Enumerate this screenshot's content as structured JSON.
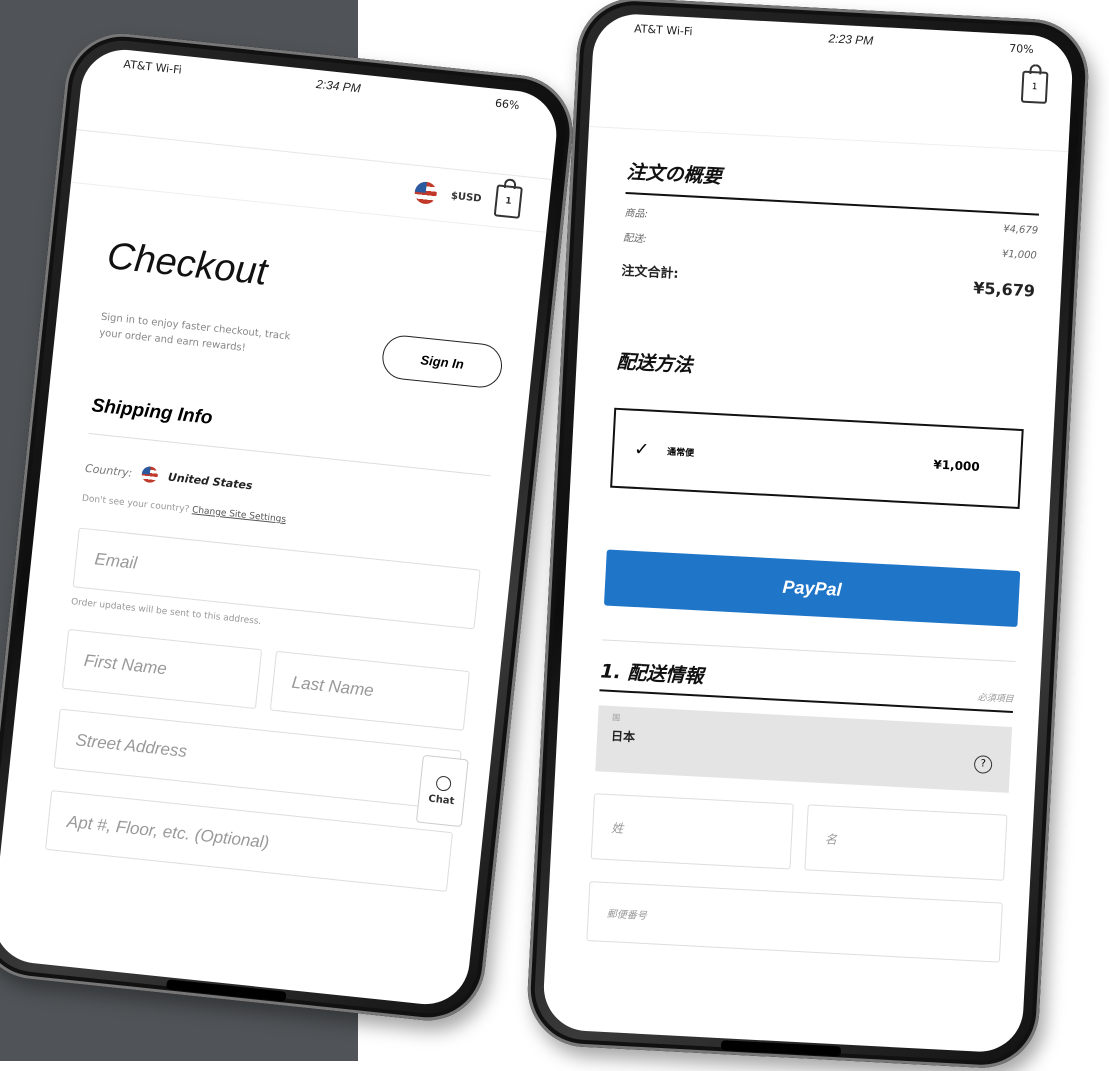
{
  "left_phone": {
    "status": {
      "carrier": "AT&T Wi-Fi",
      "time": "2:34 PM",
      "battery": "66%"
    },
    "currency": "$USD",
    "cart_count": "1",
    "title": "Checkout",
    "signin_text": "Sign in to enjoy faster checkout, track your order and earn rewards!",
    "signin_button": "Sign In",
    "section_title": "Shipping Info",
    "country_label": "Country:",
    "country_value": "United States",
    "help_text": "Don't see your country?",
    "help_link": "Change Site Settings",
    "email_placeholder": "Email",
    "email_help": "Order updates will be sent to this address.",
    "first_name_placeholder": "First Name",
    "last_name_placeholder": "Last Name",
    "street_placeholder": "Street Address",
    "chat_label": "Chat",
    "apt_placeholder": "Apt #, Floor, etc. (Optional)"
  },
  "right_phone": {
    "status": {
      "carrier": "AT&T Wi-Fi",
      "time": "2:23 PM",
      "battery": "70%"
    },
    "cart_count": "1",
    "summary_title": "注文の概要",
    "items_label": "商品:",
    "items_value": "¥4,679",
    "shipping_label": "配送:",
    "shipping_value": "¥1,000",
    "total_label": "注文合計:",
    "total_value": "¥5,679",
    "method_title": "配送方法",
    "method_name": "通常便",
    "method_price": "¥1,000",
    "paypal_label": "PayPal",
    "info_title": "1. 配送情報",
    "required_note": "必須項目",
    "country_label": "国",
    "country_value": "日本",
    "last_name_placeholder": "姓",
    "first_name_placeholder": "名",
    "zip_placeholder": "郵便番号"
  }
}
